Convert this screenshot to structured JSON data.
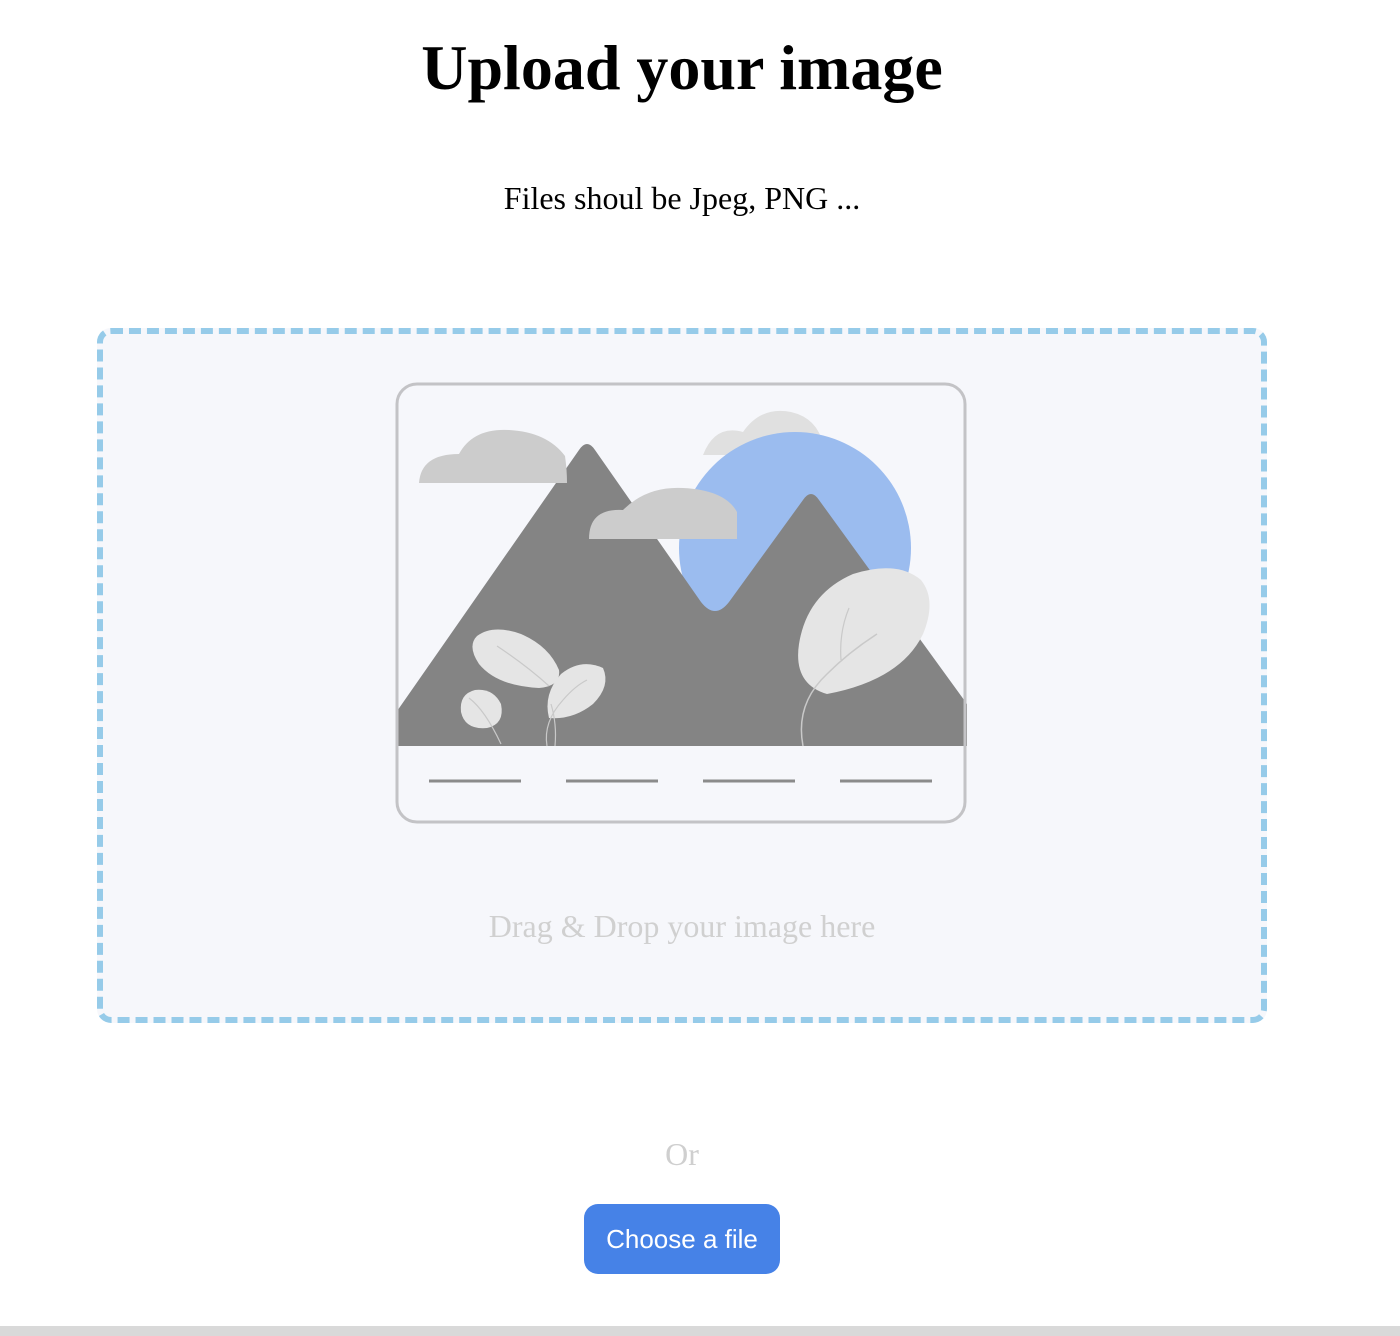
{
  "header": {
    "title": "Upload your image",
    "subtitle": "Files shoul be Jpeg, PNG ..."
  },
  "drop_zone": {
    "illustration": "image-placeholder-icon",
    "hint": "Drag & Drop your image here",
    "border_color": "#96cbe9",
    "background_color": "#f6f7fb"
  },
  "alt_text": "Or",
  "choose_button": {
    "label": "Choose a file",
    "color": "#4682e7"
  },
  "colors": {
    "mountain": "#848484",
    "sun": "#9bbcef",
    "cloud": "#cccccc",
    "leaf": "#e5e5e5",
    "frame": "#c3c3c6"
  }
}
